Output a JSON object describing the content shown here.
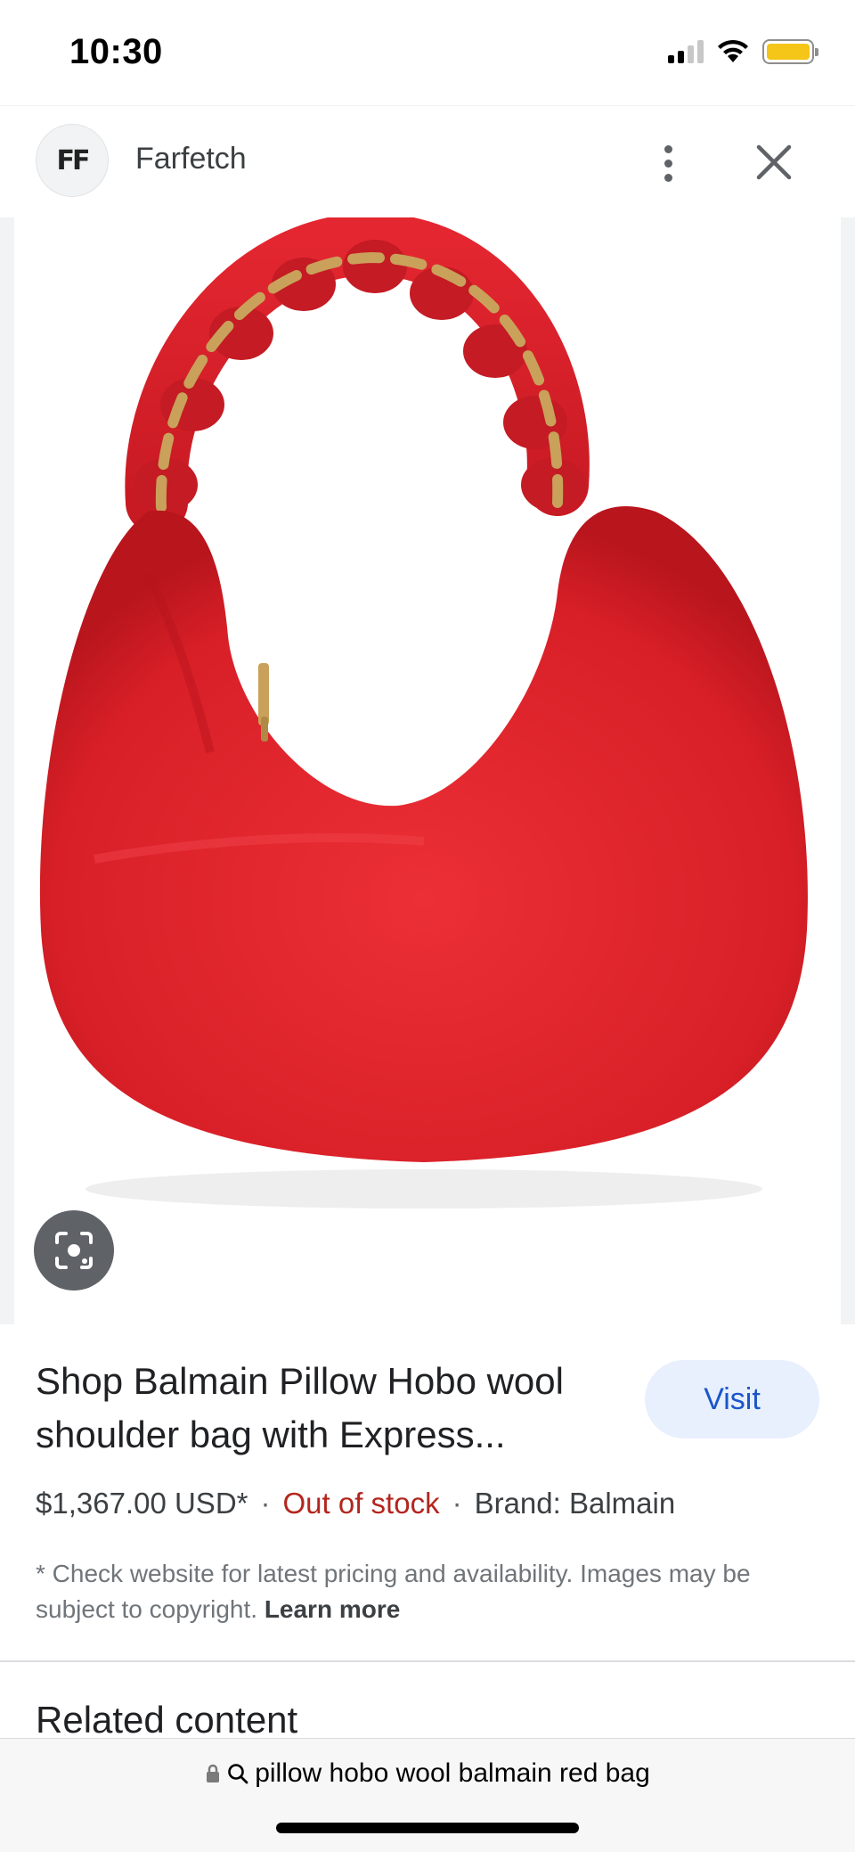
{
  "status_bar": {
    "time": "10:30",
    "icons": [
      "cellular-signal-icon",
      "wifi-icon",
      "battery-icon"
    ],
    "battery_color": "#f5c518"
  },
  "header": {
    "site_logo_text": "FF",
    "site_name": "Farfetch",
    "more_icon": "more-vert-icon",
    "close_icon": "close-icon"
  },
  "image": {
    "subject": "red-hobo-bag",
    "lens_icon": "lens-search-icon",
    "bag_color": "#e8262e",
    "chain_color": "#c9a15a"
  },
  "product": {
    "title": "Shop Balmain Pillow Hobo wool shoulder bag with Express...",
    "visit_label": "Visit",
    "price": "$1,367.00 USD*",
    "separator": "·",
    "stock": "Out of stock",
    "brand": "Brand: Balmain",
    "disclaimer": "* Check website for latest pricing and availability. Images may be subject to copyright.",
    "learn_more": "Learn more"
  },
  "related": {
    "heading": "Related content"
  },
  "url_bar": {
    "query": "pillow hobo wool balmain red bag",
    "lock_icon": "lock-icon",
    "search_icon": "search-icon"
  },
  "colors": {
    "visit_bg": "#e8f0fe",
    "visit_text": "#1a56c9",
    "stock_text": "#b3261e"
  }
}
